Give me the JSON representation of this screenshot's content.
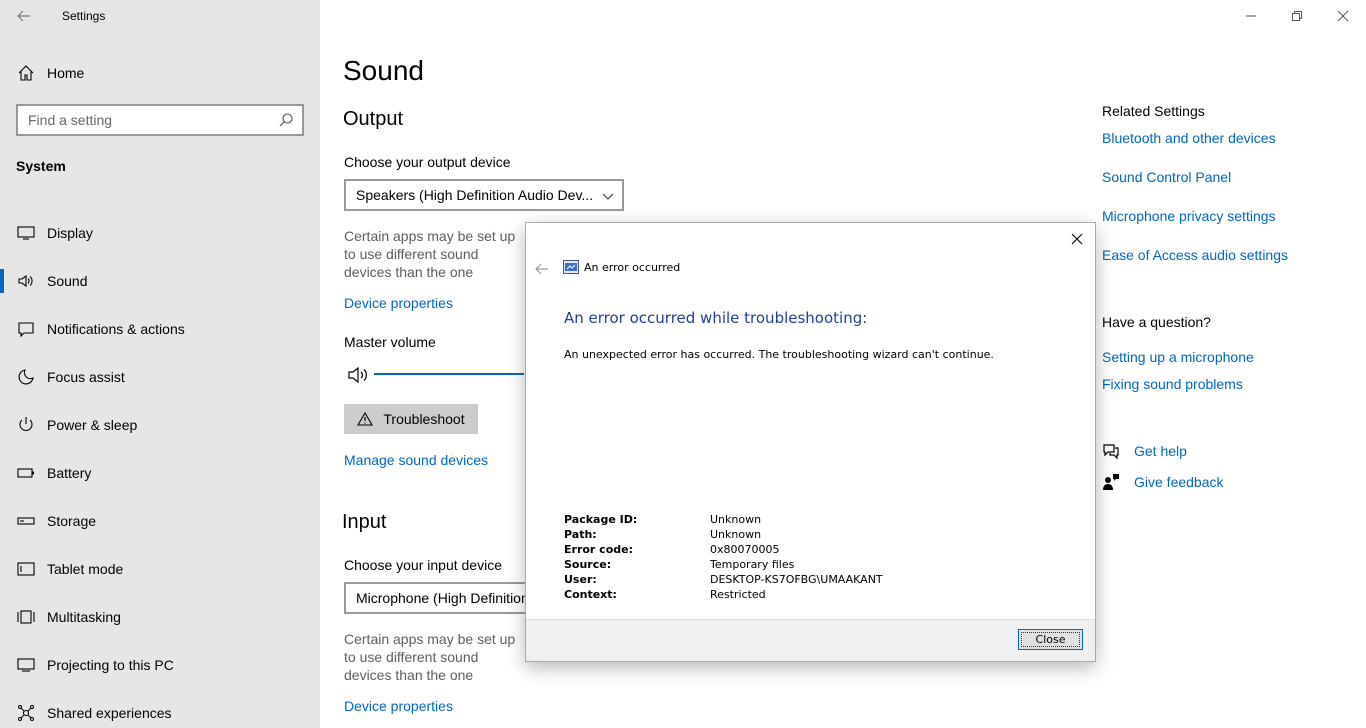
{
  "window": {
    "title": "Settings"
  },
  "sidebar": {
    "home_label": "Home",
    "search_placeholder": "Find a setting",
    "section": "System",
    "items": [
      {
        "label": "Display",
        "icon": "display-icon"
      },
      {
        "label": "Sound",
        "icon": "speaker-icon",
        "active": true
      },
      {
        "label": "Notifications & actions",
        "icon": "notifications-icon"
      },
      {
        "label": "Focus assist",
        "icon": "moon-icon"
      },
      {
        "label": "Power & sleep",
        "icon": "power-icon"
      },
      {
        "label": "Battery",
        "icon": "battery-icon"
      },
      {
        "label": "Storage",
        "icon": "storage-icon"
      },
      {
        "label": "Tablet mode",
        "icon": "tablet-icon"
      },
      {
        "label": "Multitasking",
        "icon": "multitasking-icon"
      },
      {
        "label": "Projecting to this PC",
        "icon": "projecting-icon"
      },
      {
        "label": "Shared experiences",
        "icon": "shared-icon"
      }
    ]
  },
  "main": {
    "title": "Sound",
    "output": {
      "heading": "Output",
      "choose_label": "Choose your output device",
      "device": "Speakers (High Definition Audio Dev...",
      "desc": "Certain apps may be set up to use different sound devices than the one selected here. Customize app volumes and devices in advanced sound options.",
      "device_props": "Device properties",
      "master_volume": "Master volume",
      "troubleshoot": "Troubleshoot",
      "manage": "Manage sound devices"
    },
    "input": {
      "heading": "Input",
      "choose_label": "Choose your input device",
      "device": "Microphone (High Definition Audio Device)",
      "desc": "Certain apps may be set up to use different sound devices than the one selected here. Customize app volumes and devices in advanced sound options.",
      "device_props": "Device properties"
    }
  },
  "related": {
    "heading": "Related Settings",
    "links": [
      "Bluetooth and other devices",
      "Sound Control Panel",
      "Microphone privacy settings",
      "Ease of Access audio settings"
    ],
    "question_heading": "Have a question?",
    "question_links": [
      "Setting up a microphone",
      "Fixing sound problems"
    ],
    "get_help": "Get help",
    "give_feedback": "Give feedback"
  },
  "dialog": {
    "header": "An error occurred",
    "title": "An error occurred while troubleshooting:",
    "message": "An unexpected error has occurred. The troubleshooting wizard can't continue.",
    "details": [
      {
        "key": "Package ID:",
        "value": "Unknown"
      },
      {
        "key": "Path:",
        "value": "Unknown"
      },
      {
        "key": "Error code:",
        "value": "0x80070005"
      },
      {
        "key": "Source:",
        "value": "Temporary files"
      },
      {
        "key": "User:",
        "value": "DESKTOP-KS7OFBG\\UMAAKANT"
      },
      {
        "key": "Context:",
        "value": "Restricted"
      }
    ],
    "close_label": "Close"
  }
}
